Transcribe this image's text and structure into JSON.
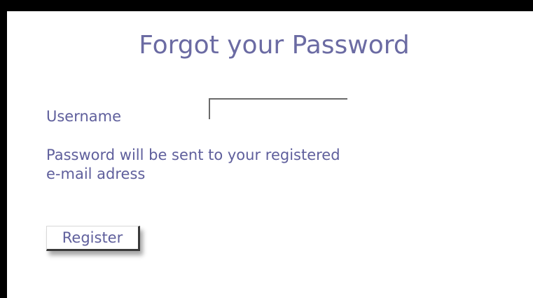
{
  "form": {
    "title": "Forgot your Password",
    "username_label": "Username",
    "username_value": "",
    "username_placeholder": "",
    "note": "Password will be sent to your registered\ne-mail adress",
    "register_label": "Register"
  },
  "colors": {
    "text": "#5f5f9c",
    "title": "#6b6ba3",
    "background": "#ffffff",
    "frame": "#000000"
  }
}
